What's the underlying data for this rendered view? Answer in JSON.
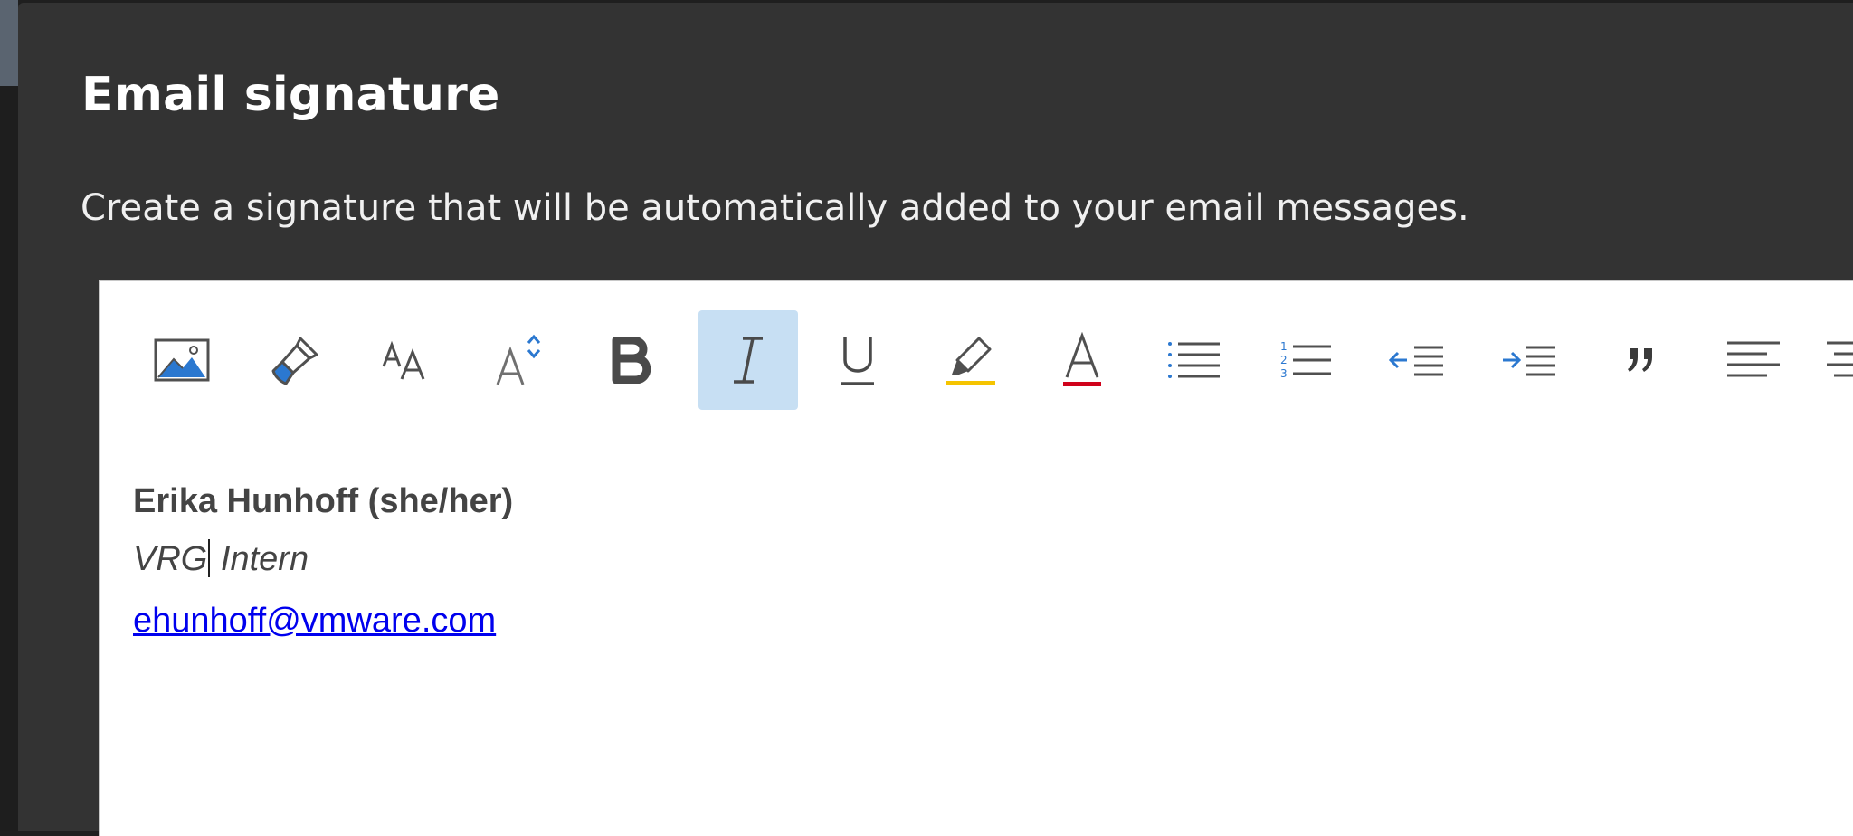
{
  "dialog": {
    "title": "Email signature",
    "description": "Create a signature that will be automatically added to your email messages."
  },
  "toolbar": {
    "buttons": [
      {
        "name": "insert-picture-button",
        "icon": "picture-icon"
      },
      {
        "name": "format-painter-button",
        "icon": "paintbrush-icon"
      },
      {
        "name": "font-button",
        "icon": "font-icon"
      },
      {
        "name": "font-size-button",
        "icon": "font-size-icon"
      },
      {
        "name": "bold-button",
        "icon": "bold-icon"
      },
      {
        "name": "italic-button",
        "icon": "italic-icon",
        "active": true
      },
      {
        "name": "underline-button",
        "icon": "underline-icon"
      },
      {
        "name": "highlight-button",
        "icon": "highlighter-icon"
      },
      {
        "name": "font-color-button",
        "icon": "font-color-icon"
      },
      {
        "name": "bullets-button",
        "icon": "bullets-icon"
      },
      {
        "name": "numbering-button",
        "icon": "numbering-icon"
      },
      {
        "name": "decrease-indent-button",
        "icon": "decrease-indent-icon"
      },
      {
        "name": "increase-indent-button",
        "icon": "increase-indent-icon"
      },
      {
        "name": "quote-button",
        "icon": "quote-icon"
      },
      {
        "name": "align-left-button",
        "icon": "align-left-icon"
      },
      {
        "name": "align-center-button",
        "icon": "align-center-icon"
      }
    ],
    "active_color": "#c7dff3",
    "highlight_color": "#f5c400",
    "font_color": "#d0021b",
    "accent_blue": "#2b78d0"
  },
  "signature": {
    "name": "Erika Hunhoff (she/her)",
    "role_before_caret": "VRG",
    "role_after_caret": " Intern",
    "email": "ehunhoff@vmware.com"
  }
}
